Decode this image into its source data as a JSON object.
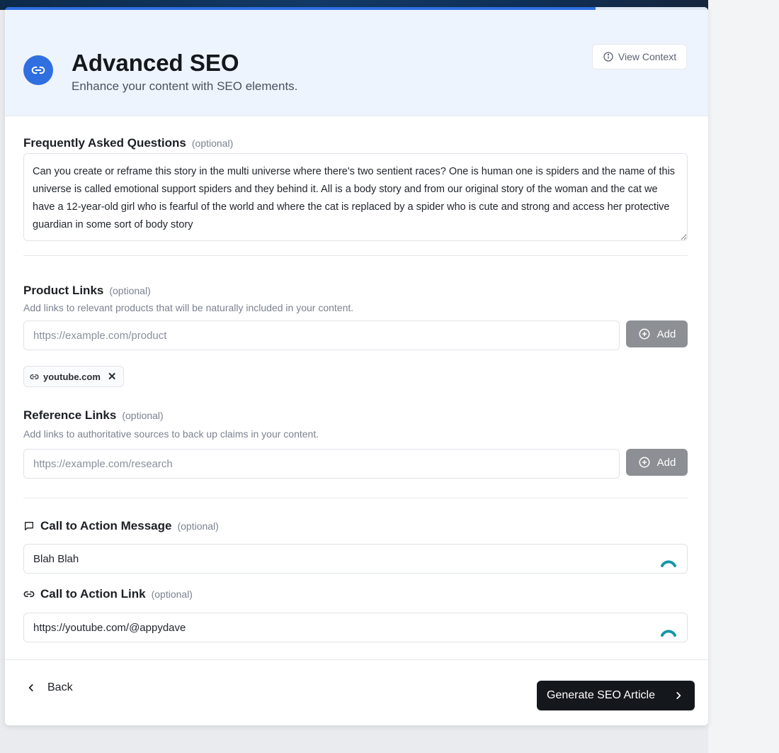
{
  "header": {
    "title": "Advanced SEO",
    "subtitle": "Enhance your content with SEO elements.",
    "view_context": "View Context",
    "icon": "link-icon",
    "progress_fraction": 0.84
  },
  "faq": {
    "label": "Frequently Asked Questions",
    "optional": "(optional)",
    "value": "Can you create or reframe this story in the multi universe where there's two sentient races? One is human one is spiders and the name of this universe is called emotional support spiders and they behind it. All is a body story and from our original story of the woman and the cat we have a 12-year-old girl who is fearful of the world and where the cat is replaced by a spider who is cute and strong and access her protective guardian in some sort of body story"
  },
  "product_links": {
    "label": "Product Links",
    "optional": "(optional)",
    "description": "Add links to relevant products that will be naturally included in your content.",
    "placeholder": "https://example.com/product",
    "add_label": "Add",
    "chips": [
      {
        "label": "youtube.com"
      }
    ]
  },
  "reference_links": {
    "label": "Reference Links",
    "optional": "(optional)",
    "description": "Add links to authoritative sources to back up claims in your content.",
    "placeholder": "https://example.com/research",
    "add_label": "Add"
  },
  "cta_message": {
    "label": "Call to Action Message",
    "optional": "(optional)",
    "value": "Blah Blah"
  },
  "cta_link": {
    "label": "Call to Action Link",
    "optional": "(optional)",
    "value": "https://youtube.com/@appydave"
  },
  "footer": {
    "back_label": "Back",
    "generate_label": "Generate SEO Article"
  },
  "colors": {
    "accent": "#2f6fe0",
    "header_bg": "#eef4fd",
    "add_button": "#8c8f94",
    "primary_button": "#14171c"
  }
}
